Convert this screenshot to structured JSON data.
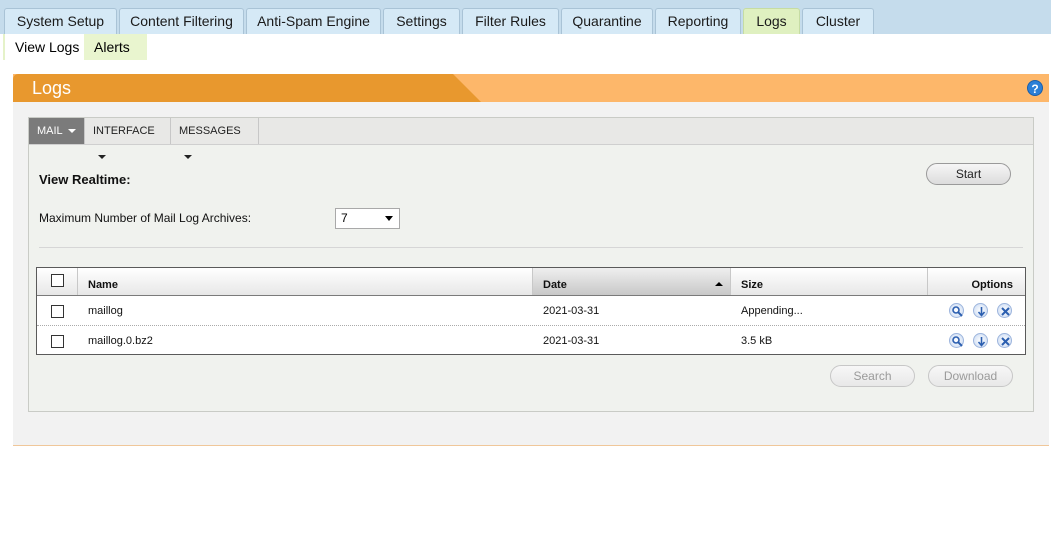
{
  "top_tabs": [
    "System Setup",
    "Content Filtering",
    "Anti-Spam Engine",
    "Settings",
    "Filter Rules",
    "Quarantine",
    "Reporting",
    "Logs",
    "Cluster"
  ],
  "active_top_tab": "Logs",
  "sub_tabs": [
    "View Logs",
    "Alerts"
  ],
  "panel": {
    "title": "Logs",
    "help_icon": "?"
  },
  "inner_tabs": [
    {
      "label": "MAIL",
      "icon": "caret-down-icon"
    },
    {
      "label": "INTERFACE",
      "icon": "caret-down-icon"
    },
    {
      "label": "MESSAGES",
      "icon": "caret-down-icon"
    }
  ],
  "realtime": {
    "label": "View Realtime:",
    "button": "Start"
  },
  "archives": {
    "label": "Maximum Number of Mail Log Archives:",
    "value": "7"
  },
  "table": {
    "columns": [
      "Name",
      "Date",
      "Size",
      "Options"
    ],
    "sort_column": "Date",
    "rows": [
      {
        "name": "maillog",
        "date": "2021-03-31",
        "size": "Appending..."
      },
      {
        "name": "maillog.0.bz2",
        "date": "2021-03-31",
        "size": "3.5 kB"
      }
    ]
  },
  "actions": {
    "search": "Search",
    "download": "Download"
  },
  "colors": {
    "header_orange": "#e8982e",
    "header_light": "#fdb76a",
    "tab_blue": "#d5e9f6",
    "tab_active": "#dff0c0"
  }
}
